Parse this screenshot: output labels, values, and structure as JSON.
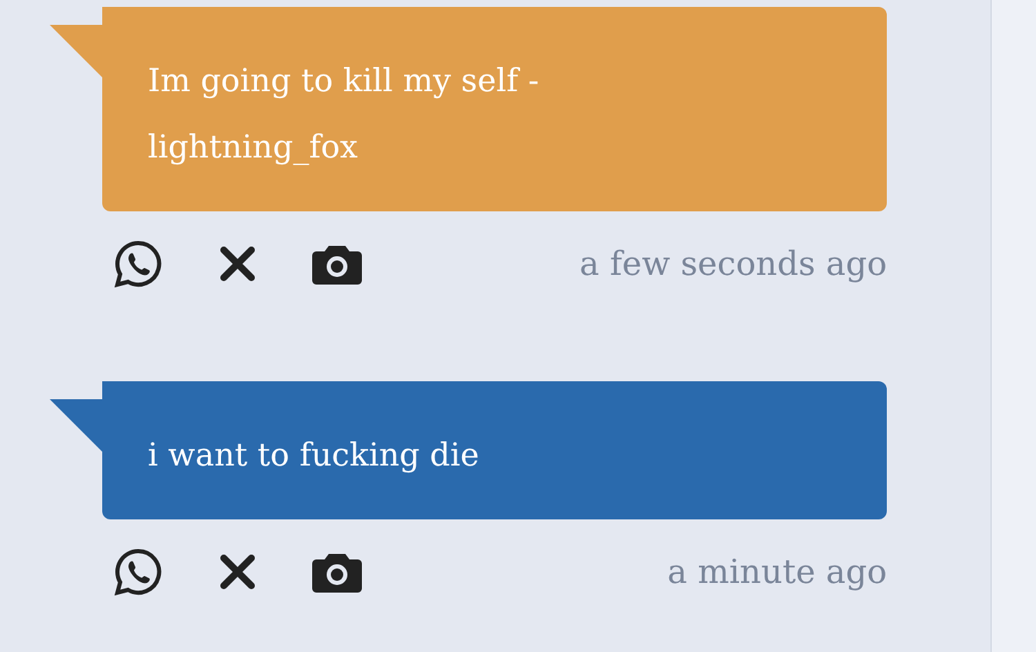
{
  "messages": [
    {
      "text": "Im going to kill my self - lightning_fox",
      "color": "#e09e4c",
      "time": "a few seconds ago"
    },
    {
      "text": "i want to fucking die",
      "color": "#2a6aad",
      "time": "a minute ago"
    }
  ]
}
